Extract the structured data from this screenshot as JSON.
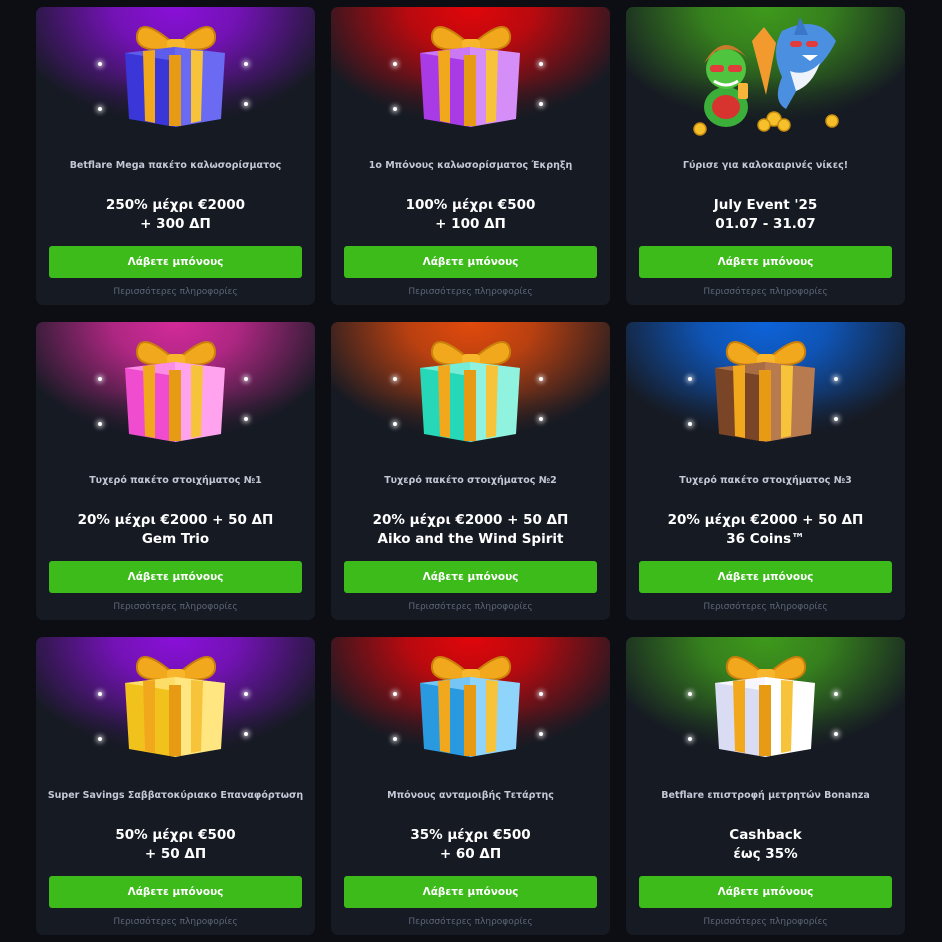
{
  "cta_label": "Λάβετε μπόνους",
  "more_label": "Περισσότερες πληροφορίες",
  "cards": [
    {
      "subtitle": "Betflare Mega πακέτο καλωσορίσματος",
      "line1": "250% μέχρι €2000",
      "line2": "+ 300 ΔΠ",
      "glow": "#8a10d9",
      "box": "#3a36d8",
      "boxLight": "#6a6af2"
    },
    {
      "subtitle": "1ο Μπόνους καλωσορίσματος Έκρηξη",
      "line1": "100% μέχρι €500",
      "line2": "+ 100 ΔΠ",
      "glow": "#e1060a",
      "box": "#a83be6",
      "boxLight": "#d58ef7"
    },
    {
      "subtitle": "Γύρισε για καλοκαιρινές νίκες!",
      "line1": "July Event '25",
      "line2": "01.07 - 31.07",
      "glow": "#3e9a1c",
      "event": true
    },
    {
      "subtitle": "Τυχερό πακέτο στοιχήματος №1",
      "line1": "20% μέχρι €2000 + 50 ΔΠ",
      "line2": "Gem Trio",
      "glow": "#d42a9a",
      "box": "#f04cd0",
      "boxLight": "#ffa3ee"
    },
    {
      "subtitle": "Τυχερό πακέτο στοιχήματος №2",
      "line1": "20% μέχρι €2000 + 50 ΔΠ",
      "line2": "Aiko and the Wind Spirit",
      "glow": "#e24a0c",
      "box": "#27d8b8",
      "boxLight": "#8ff3e0"
    },
    {
      "subtitle": "Τυχερό πακέτο στοιχήματος №3",
      "line1": "20% μέχρι €2000 + 50 ΔΠ",
      "line2": "36 Coins™",
      "glow": "#0d63da",
      "box": "#7a4526",
      "boxLight": "#b87b50"
    },
    {
      "subtitle": "Super Savings Σαββατοκύριακο Επαναφόρτωση",
      "line1": "50% μέχρι €500",
      "line2": "+ 50 ΔΠ",
      "glow": "#8a10d9",
      "box": "#f2c21c",
      "boxLight": "#ffe680"
    },
    {
      "subtitle": "Μπόνους ανταμοιβής Τετάρτης",
      "line1": "35% μέχρι €500",
      "line2": "+ 60 ΔΠ",
      "glow": "#e1060a",
      "box": "#2a9ae0",
      "boxLight": "#8fd4fb"
    },
    {
      "subtitle": "Betflare επιστροφή μετρητών Bonanza",
      "line1": "Cashback",
      "line2": "έως 35%",
      "glow": "#3e9a1c",
      "box": "#d9dcf2",
      "boxLight": "#ffffff"
    }
  ]
}
